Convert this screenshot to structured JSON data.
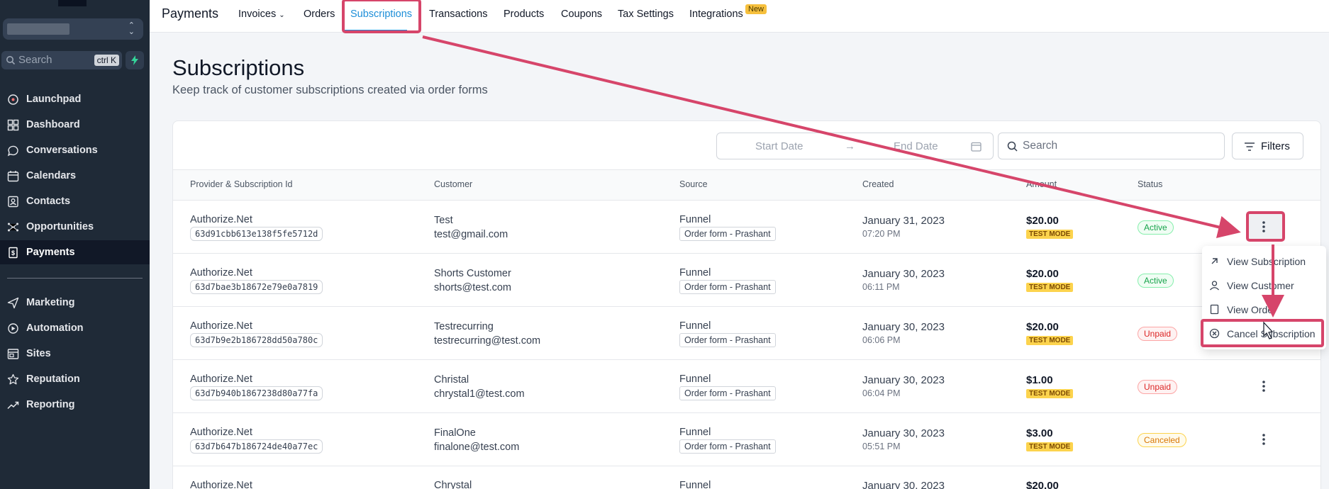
{
  "sidebar": {
    "search_label": "Search",
    "search_shortcut": "ctrl K",
    "items": [
      {
        "label": "Launchpad",
        "icon": "launchpad-icon"
      },
      {
        "label": "Dashboard",
        "icon": "dashboard-icon"
      },
      {
        "label": "Conversations",
        "icon": "chat-icon"
      },
      {
        "label": "Calendars",
        "icon": "calendar-icon"
      },
      {
        "label": "Contacts",
        "icon": "contacts-icon"
      },
      {
        "label": "Opportunities",
        "icon": "opportunities-icon"
      },
      {
        "label": "Payments",
        "icon": "payments-icon",
        "active": true
      },
      {
        "label": "Marketing",
        "icon": "send-icon"
      },
      {
        "label": "Automation",
        "icon": "automation-icon"
      },
      {
        "label": "Sites",
        "icon": "sites-icon"
      },
      {
        "label": "Reputation",
        "icon": "star-icon"
      },
      {
        "label": "Reporting",
        "icon": "trend-icon"
      }
    ]
  },
  "topnav": {
    "brand": "Payments",
    "tabs": [
      "Invoices",
      "Orders",
      "Subscriptions",
      "Transactions",
      "Products",
      "Coupons",
      "Tax Settings",
      "Integrations"
    ],
    "active_tab": "Subscriptions",
    "new_badge": "New"
  },
  "page": {
    "title": "Subscriptions",
    "subtitle": "Keep track of customer subscriptions created via order forms"
  },
  "toolbar": {
    "start_date_placeholder": "Start Date",
    "end_date_placeholder": "End Date",
    "search_placeholder": "Search",
    "filters_label": "Filters"
  },
  "table": {
    "headers": [
      "Provider & Subscription Id",
      "Customer",
      "Source",
      "Created",
      "Amount",
      "Status"
    ],
    "rows": [
      {
        "provider": "Authorize.Net",
        "sub_id": "63d91cbb613e138f5fe5712d",
        "customer": "Test",
        "email": "test@gmail.com",
        "source": "Funnel",
        "form": "Order form - Prashant",
        "date": "January 31, 2023",
        "time": "07:20 PM",
        "amount": "$20.00",
        "mode": "TEST MODE",
        "status": "Active"
      },
      {
        "provider": "Authorize.Net",
        "sub_id": "63d7bae3b18672e79e0a7819",
        "customer": "Shorts Customer",
        "email": "shorts@test.com",
        "source": "Funnel",
        "form": "Order form - Prashant",
        "date": "January 30, 2023",
        "time": "06:11 PM",
        "amount": "$20.00",
        "mode": "TEST MODE",
        "status": "Active"
      },
      {
        "provider": "Authorize.Net",
        "sub_id": "63d7b9e2b186728dd50a780c",
        "customer": "Testrecurring",
        "email": "testrecurring@test.com",
        "source": "Funnel",
        "form": "Order form - Prashant",
        "date": "January 30, 2023",
        "time": "06:06 PM",
        "amount": "$20.00",
        "mode": "TEST MODE",
        "status": "Unpaid"
      },
      {
        "provider": "Authorize.Net",
        "sub_id": "63d7b940b1867238d80a77fa",
        "customer": "Christal",
        "email": "chrystal1@test.com",
        "source": "Funnel",
        "form": "Order form - Prashant",
        "date": "January 30, 2023",
        "time": "06:04 PM",
        "amount": "$1.00",
        "mode": "TEST MODE",
        "status": "Unpaid"
      },
      {
        "provider": "Authorize.Net",
        "sub_id": "63d7b647b186724de40a77ec",
        "customer": "FinalOne",
        "email": "finalone@test.com",
        "source": "Funnel",
        "form": "Order form - Prashant",
        "date": "January 30, 2023",
        "time": "05:51 PM",
        "amount": "$3.00",
        "mode": "TEST MODE",
        "status": "Canceled"
      },
      {
        "provider": "Authorize.Net",
        "sub_id": "",
        "customer": "Chrystal",
        "email": "",
        "source": "Funnel",
        "form": "",
        "date": "January 30, 2023",
        "time": "",
        "amount": "$20.00",
        "mode": "",
        "status": ""
      }
    ]
  },
  "menu": {
    "items": [
      "View Subscription",
      "View Customer",
      "View Order",
      "Cancel Subscription"
    ]
  },
  "colors": {
    "sidebar_bg": "#1f2a37",
    "accent": "#1d8ed8",
    "annotation": "#d6456a"
  }
}
